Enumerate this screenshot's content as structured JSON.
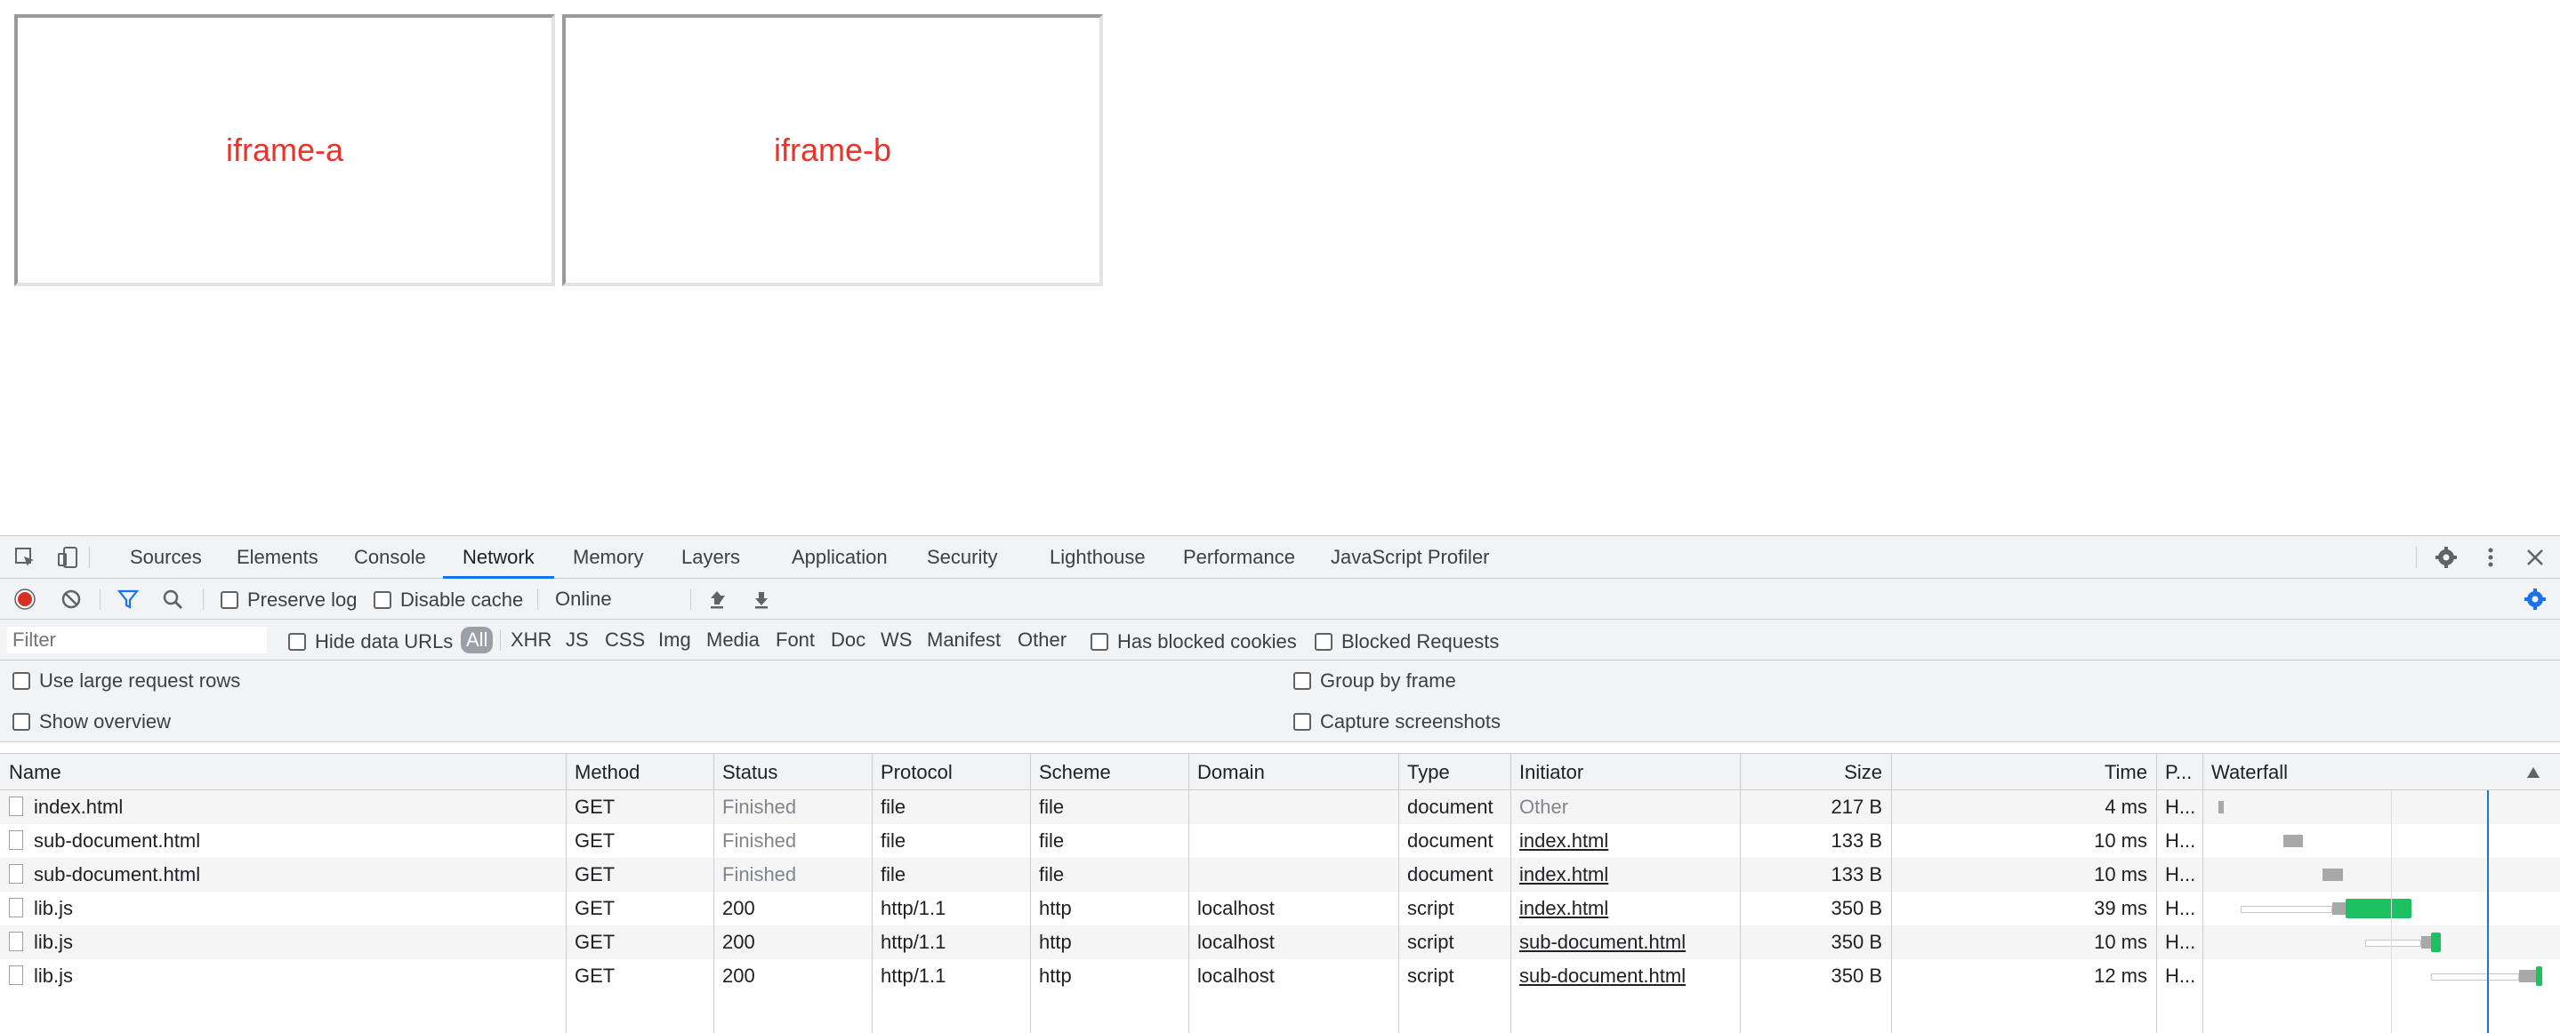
{
  "page": {
    "iframes": [
      {
        "label": "iframe-a"
      },
      {
        "label": "iframe-b"
      }
    ]
  },
  "devtools": {
    "tabs": [
      {
        "label": "Sources"
      },
      {
        "label": "Elements"
      },
      {
        "label": "Console"
      },
      {
        "label": "Network",
        "active": true
      },
      {
        "label": "Memory"
      },
      {
        "label": "Layers"
      },
      {
        "label": "Application"
      },
      {
        "label": "Security"
      },
      {
        "label": "Lighthouse"
      },
      {
        "label": "Performance"
      },
      {
        "label": "JavaScript Profiler"
      }
    ],
    "toolbar": {
      "preserve_log": "Preserve log",
      "disable_cache": "Disable cache",
      "throttling": "Online"
    },
    "filterbar": {
      "placeholder": "Filter",
      "hide_data_urls": "Hide data URLs",
      "types": [
        "All",
        "XHR",
        "JS",
        "CSS",
        "Img",
        "Media",
        "Font",
        "Doc",
        "WS",
        "Manifest",
        "Other"
      ],
      "has_blocked_cookies": "Has blocked cookies",
      "blocked_requests": "Blocked Requests"
    },
    "settings": {
      "large_rows": "Use large request rows",
      "show_overview": "Show overview",
      "group_by_frame": "Group by frame",
      "capture_screenshots": "Capture screenshots"
    },
    "table": {
      "columns": [
        "Name",
        "Method",
        "Status",
        "Protocol",
        "Scheme",
        "Domain",
        "Type",
        "Initiator",
        "Size",
        "Time",
        "P...",
        "Waterfall"
      ],
      "rows": [
        {
          "name": "index.html",
          "method": "GET",
          "status": "Finished",
          "protocol": "file",
          "scheme": "file",
          "domain": "",
          "type": "document",
          "initiator": "Other",
          "size": "217 B",
          "time": "4 ms",
          "priority": "H...",
          "wf_wait": [
            0.01,
            0.02
          ],
          "wf_recv": null
        },
        {
          "name": "sub-document.html",
          "method": "GET",
          "status": "Finished",
          "protocol": "file",
          "scheme": "file",
          "domain": "",
          "type": "document",
          "initiator": "index.html",
          "size": "133 B",
          "time": "10 ms",
          "priority": "H...",
          "wf_wait": [
            0.21,
            0.27
          ],
          "wf_recv": null
        },
        {
          "name": "sub-document.html",
          "method": "GET",
          "status": "Finished",
          "protocol": "file",
          "scheme": "file",
          "domain": "",
          "type": "document",
          "initiator": "index.html",
          "size": "133 B",
          "time": "10 ms",
          "priority": "H...",
          "wf_wait": [
            0.33,
            0.39
          ],
          "wf_recv": null
        },
        {
          "name": "lib.js",
          "method": "GET",
          "status": "200",
          "protocol": "http/1.1",
          "scheme": "http",
          "domain": "localhost",
          "type": "script",
          "initiator": "index.html",
          "size": "350 B",
          "time": "39 ms",
          "priority": "H...",
          "wf_queue": [
            0.08,
            0.36
          ],
          "wf_wait": [
            0.36,
            0.4
          ],
          "wf_recv": [
            0.4,
            0.6
          ]
        },
        {
          "name": "lib.js",
          "method": "GET",
          "status": "200",
          "protocol": "http/1.1",
          "scheme": "http",
          "domain": "localhost",
          "type": "script",
          "initiator": "sub-document.html",
          "size": "350 B",
          "time": "10 ms",
          "priority": "H...",
          "wf_queue": [
            0.46,
            0.63
          ],
          "wf_wait": [
            0.63,
            0.66
          ],
          "wf_recv": [
            0.66,
            0.69
          ]
        },
        {
          "name": "lib.js",
          "method": "GET",
          "status": "200",
          "protocol": "http/1.1",
          "scheme": "http",
          "domain": "localhost",
          "type": "script",
          "initiator": "sub-document.html",
          "size": "350 B",
          "time": "12 ms",
          "priority": "H...",
          "wf_queue": [
            0.66,
            0.93
          ],
          "wf_wait": [
            0.93,
            0.98
          ],
          "wf_recv": [
            0.98,
            1.0
          ]
        }
      ]
    },
    "colors": {
      "accent": "#1a73e8",
      "record": "#d93025",
      "receive": "#1ec160",
      "wait": "#a8a8a8"
    }
  }
}
